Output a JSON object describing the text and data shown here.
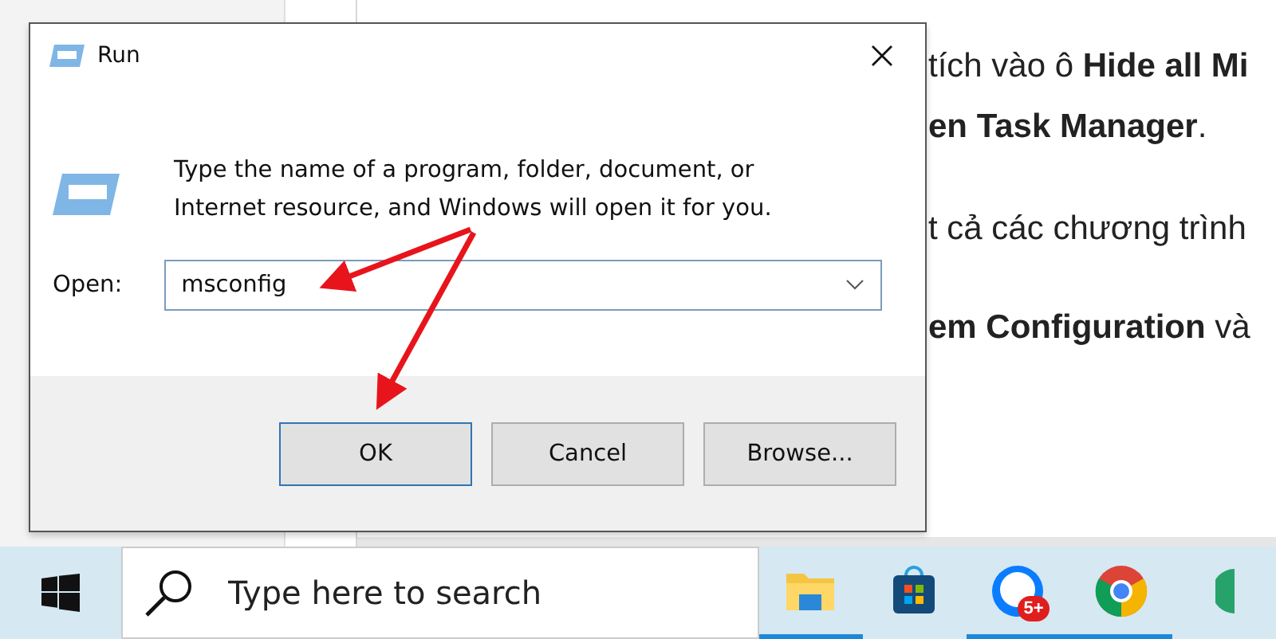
{
  "document": {
    "lines": [
      {
        "text": "tích vào ô **Hide all Mi**"
      },
      {
        "text": "**en Task Manager**."
      },
      {
        "text": "t cả các chương trình"
      },
      {
        "text": "**em Configuration** và"
      }
    ]
  },
  "dialog": {
    "title": "Run",
    "description": "Type the name of a program, folder, document, or Internet resource, and Windows will open it for you.",
    "open_label": "Open:",
    "open_value": "msconfig",
    "buttons": [
      {
        "label": "OK",
        "selected": true
      },
      {
        "label": "Cancel",
        "selected": false
      },
      {
        "label": "Browse...",
        "selected": false
      }
    ]
  },
  "taskbar": {
    "search": {
      "placeholder": "Type here to search"
    },
    "apps": [
      {
        "kind": "folder",
        "active": true
      },
      {
        "kind": "store",
        "active": false
      },
      {
        "kind": "chat",
        "active": true,
        "badge": "5+"
      },
      {
        "kind": "browser",
        "active": true
      },
      {
        "kind": "edge",
        "active": false
      }
    ]
  }
}
